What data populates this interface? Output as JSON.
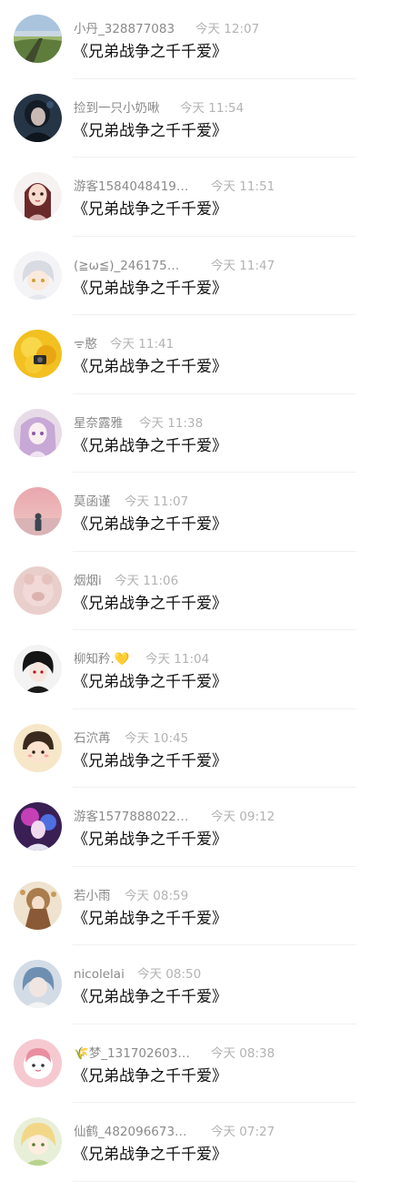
{
  "messages": [
    {
      "user": "小丹_328877083",
      "time": "今天 12:07",
      "text": "《兄弟战争之千千爱》",
      "avatar": "landscape-avatar"
    },
    {
      "user": "捡到一只小奶啾",
      "time": "今天 11:54",
      "text": "《兄弟战争之千千爱》",
      "avatar": "dark-girl-avatar"
    },
    {
      "user": "游客1584048419…",
      "time": "今天 11:51",
      "text": "《兄弟战争之千千爱》",
      "avatar": "cartoon-girl-avatar"
    },
    {
      "user": "(≧ω≦)_246175…",
      "time": "今天 11:47",
      "text": "《兄弟战争之千千爱》",
      "avatar": "anime-boy-avatar"
    },
    {
      "user": "ᯤ憨",
      "time": "今天 11:41",
      "text": "《兄弟战争之千千爱》",
      "avatar": "yellow-flower-avatar"
    },
    {
      "user": "星奈露雅",
      "time": "今天 11:38",
      "text": "《兄弟战争之千千爱》",
      "avatar": "anime-girl-purple-avatar"
    },
    {
      "user": "莫函谨",
      "time": "今天 11:07",
      "text": "《兄弟战争之千千爱》",
      "avatar": "sunset-person-avatar"
    },
    {
      "user": "烟烟i",
      "time": "今天 11:06",
      "text": "《兄弟战争之千千爱》",
      "avatar": "pink-bear-avatar"
    },
    {
      "user": "柳知矜.💛",
      "time": "今天 11:04",
      "text": "《兄弟战争之千千爱》",
      "avatar": "black-hair-boy-avatar"
    },
    {
      "user": "石泬苒",
      "time": "今天 10:45",
      "text": "《兄弟战争之千千爱》",
      "avatar": "cute-boy-avatar"
    },
    {
      "user": "游客1577888022…",
      "time": "今天 09:12",
      "text": "《兄弟战争之千千爱》",
      "avatar": "purple-light-avatar"
    },
    {
      "user": "若小雨",
      "time": "今天 08:59",
      "text": "《兄弟战争之千千爱》",
      "avatar": "ornate-girl-avatar"
    },
    {
      "user": "nicolelai",
      "time": "今天 08:50",
      "text": "《兄弟战争之千千爱》",
      "avatar": "blue-hair-girl-avatar"
    },
    {
      "user": "🌾梦_131702603…",
      "time": "今天 08:38",
      "text": "《兄弟战争之千千爱》",
      "avatar": "pink-sticker-avatar"
    },
    {
      "user": "仙鹤_482096673…",
      "time": "今天 07:27",
      "text": "《兄弟战争之千千爱》",
      "avatar": "blonde-chibi-avatar"
    }
  ],
  "colors": {
    "username": "#8a8a8a",
    "timestamp": "#b3b3b3",
    "message": "#111111",
    "divider": "#f1f1f1"
  }
}
